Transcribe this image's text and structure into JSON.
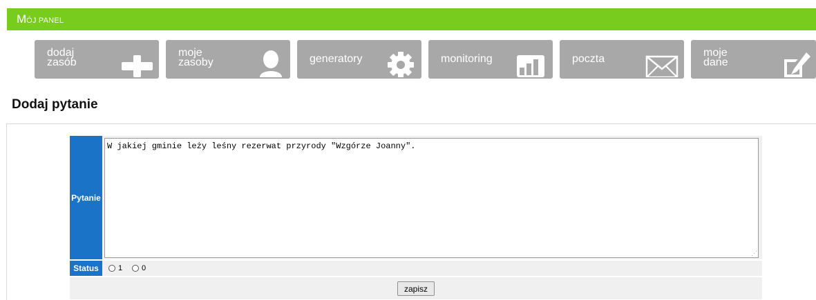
{
  "header": {
    "title_first_letter": "M",
    "title_rest": "ÓJ PANEL"
  },
  "nav": [
    {
      "label": "dodaj\nzasób",
      "icon": "plus-icon"
    },
    {
      "label": "moje\nzasoby",
      "icon": "user-icon"
    },
    {
      "label": "generatory",
      "icon": "gear-icon"
    },
    {
      "label": "monitoring",
      "icon": "bar-chart-icon"
    },
    {
      "label": "poczta",
      "icon": "envelope-icon"
    },
    {
      "label": "moje\ndane",
      "icon": "edit-icon"
    }
  ],
  "page": {
    "title": "Dodaj pytanie"
  },
  "form": {
    "question_label": "Pytanie",
    "question_value": "W jakiej gminie leży leśny rezerwat przyrody \"Wzgórze Joanny\".",
    "status_label": "Status",
    "status_options": [
      "1",
      "0"
    ],
    "save_label": "zapisz"
  },
  "colors": {
    "header_green": "#78cc1e",
    "nav_gray": "#a8a8a8",
    "label_blue": "#1a73c7"
  }
}
